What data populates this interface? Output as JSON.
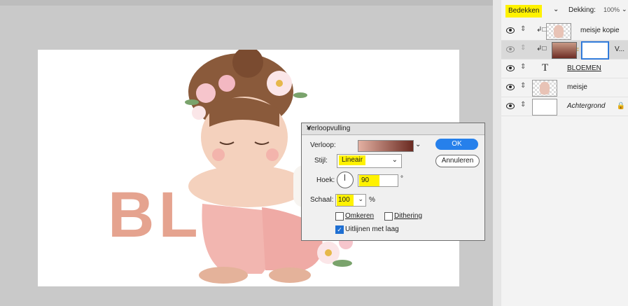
{
  "canvas": {
    "document_text": "BL"
  },
  "layers_panel": {
    "blend_mode": "Bedekken",
    "opacity_label": "Dekking:",
    "opacity_value": "100%",
    "layers": [
      {
        "name": "meisje kopie",
        "style": "normal"
      },
      {
        "name": "V...",
        "style": "normal"
      },
      {
        "name": "BLOEMEN",
        "style": "underline"
      },
      {
        "name": "meisje",
        "style": "normal"
      },
      {
        "name": "Achtergrond",
        "style": "italic"
      }
    ]
  },
  "dialog": {
    "title": "Verloopvulling",
    "close": "×",
    "verloop_label": "Verloop:",
    "stijl_label": "Stijl:",
    "stijl_value": "Lineair",
    "hoek_label": "Hoek:",
    "hoek_value": "90",
    "degree_symbol": "°",
    "schaal_label": "Schaal:",
    "schaal_value": "100",
    "percent": "%",
    "omkeren_label": "Omkeren",
    "dithering_label": "Dithering",
    "uitlijnen_label": "Uitlijnen met laag",
    "ok_label": "OK",
    "annuleren_label": "Annuleren",
    "checkboxes": {
      "omkeren": false,
      "dithering": false,
      "uitlijnen": true
    }
  },
  "colors": {
    "highlight": "#fff200",
    "ok_button": "#2680eb",
    "gradient_start": "#e3b0a2",
    "gradient_end": "#6a2a21",
    "big_text": "#e5a38f"
  }
}
